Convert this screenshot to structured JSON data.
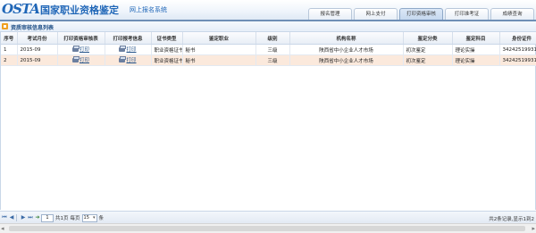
{
  "header": {
    "logo": "OSTA",
    "title": "国家职业资格鉴定",
    "subtitle": "网上报名系统",
    "tabs": [
      "报名管理",
      "网上支付",
      "打印资格审核",
      "打印准考证",
      "成绩查询"
    ]
  },
  "panel": {
    "title": "资质审核信息列表"
  },
  "table": {
    "columns": [
      "序号",
      "考试月份",
      "打印资格审核表",
      "打印报考信息",
      "证书类型",
      "鉴定职业",
      "级别",
      "机构名称",
      "鉴定分类",
      "鉴定科目",
      "身份证件"
    ],
    "rows": [
      [
        "1",
        "2015-09",
        "打印",
        "打印",
        "职业资格证书",
        "秘书",
        "三级",
        "陕西省中小企业人才市场",
        "初次鉴定",
        "理论实操",
        "342425199310"
      ],
      [
        "2",
        "2015-09",
        "打印",
        "打印",
        "职业资格证书",
        "秘书",
        "三级",
        "陕西省中小企业人才市场",
        "初次鉴定",
        "理论实操",
        "342425199310"
      ]
    ]
  },
  "pager": {
    "page": "1",
    "of_pages": "共1页",
    "per_page_label": "每页",
    "page_size": "15",
    "per_page_unit": "条",
    "info": "共2条记录,显示1到2"
  },
  "icons": [
    "first-page-icon",
    "prev-page-icon",
    "next-page-icon",
    "last-page-icon",
    "refresh-icon",
    "printer-icon"
  ]
}
